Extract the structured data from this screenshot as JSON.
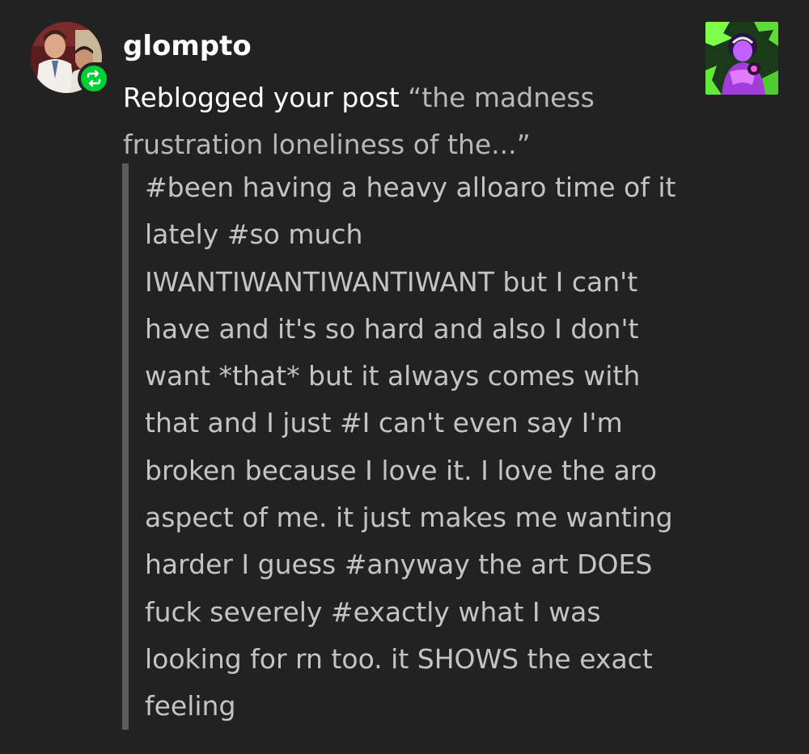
{
  "notification": {
    "username": "glompto",
    "action": "Reblogged your post",
    "post_title": "“the madness frustration loneliness of the...”",
    "tags_text": "#been having a heavy alloaro time of it lately #so much IWANTIWANTIWANTIWANT but I can't have and it's so hard and also I don't want *that* but it always comes with that and I just #I can't even say I'm broken because I love it. I love the aro aspect of me. it just makes me wanting harder I guess #anyway the art DOES fuck severely #exactly what I was looking for rn too. it SHOWS the exact feeling",
    "badge_icon": "reblog-icon",
    "colors": {
      "background": "#222222",
      "badge": "#00cf35",
      "quote_bar": "#5c5c5c",
      "secondary_text": "#b8b8b8"
    }
  }
}
